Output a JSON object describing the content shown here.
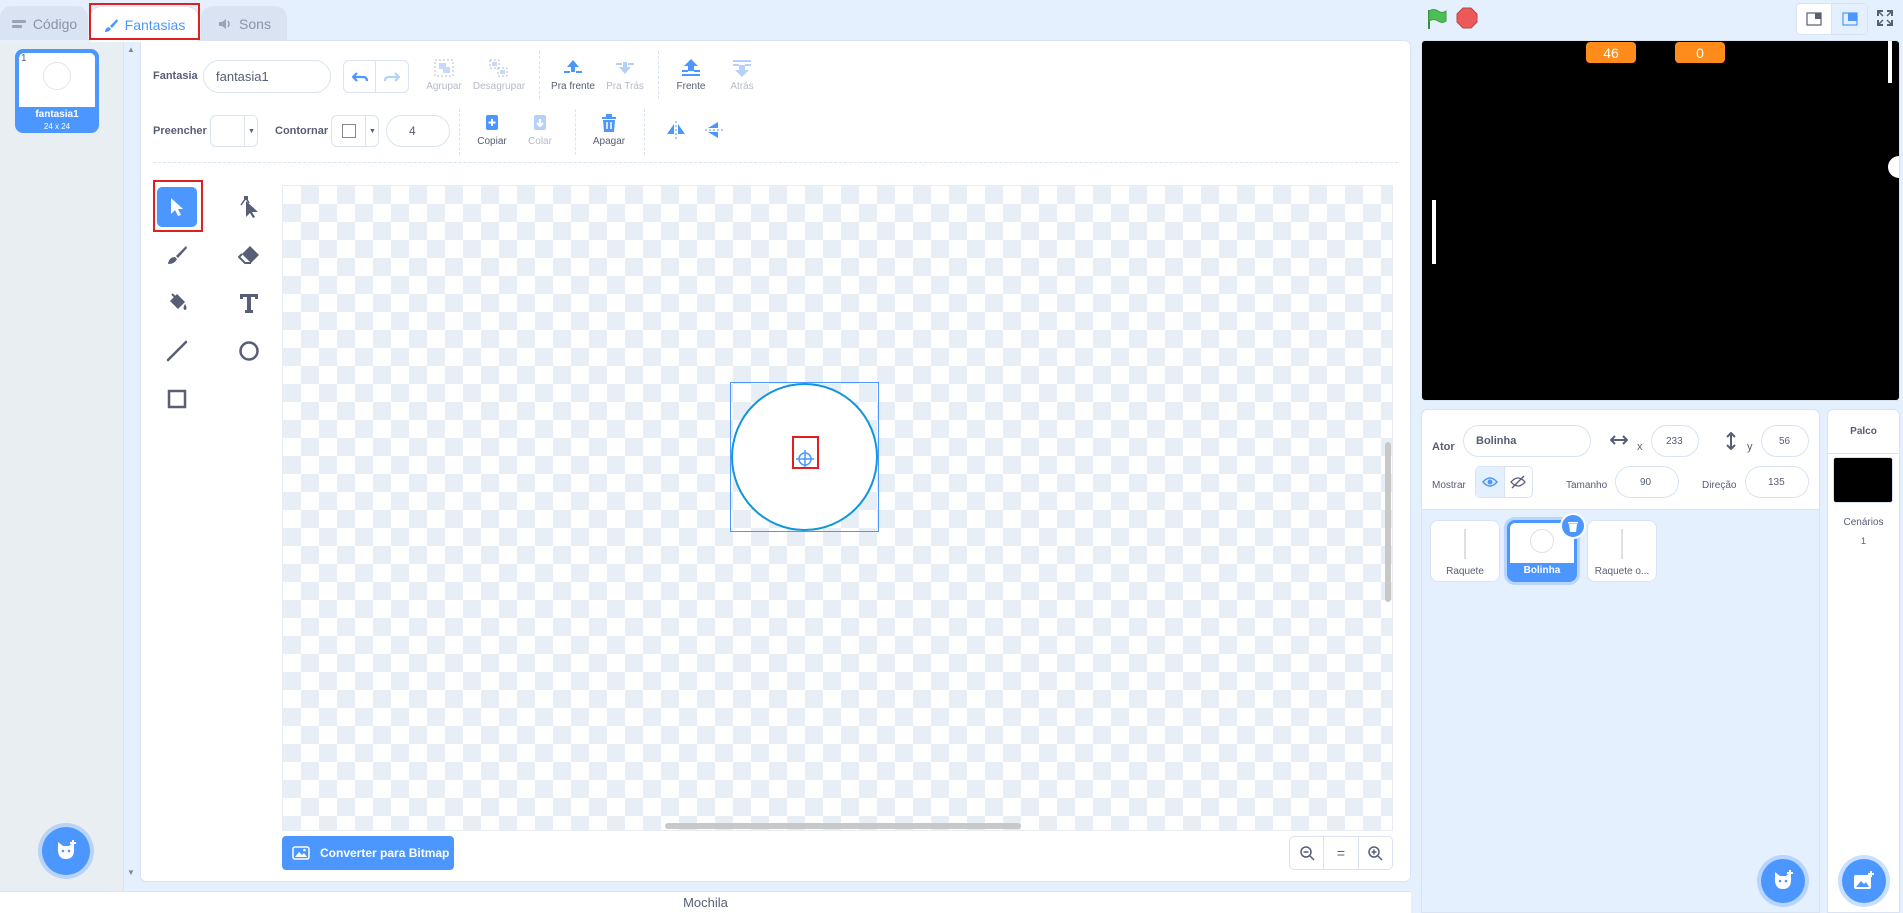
{
  "tabs": [
    {
      "label": "Código"
    },
    {
      "label": "Fantasias"
    },
    {
      "label": "Sons"
    }
  ],
  "costume_list": {
    "number": "1",
    "name": "fantasia1",
    "size": "24 x 24"
  },
  "toolbar": {
    "costume_label": "Fantasia",
    "costume_name": "fantasia1",
    "group": "Agrupar",
    "ungroup": "Desagrupar",
    "forward": "Pra frente",
    "backward": "Pra Trás",
    "front": "Frente",
    "back": "Atrás",
    "fill_label": "Preencher",
    "outline_label": "Contornar",
    "outline_width": "4",
    "copy": "Copiar",
    "paste": "Colar",
    "delete": "Apagar"
  },
  "convert_button": "Converter para Bitmap",
  "zoom": {
    "equal": "="
  },
  "backpack": "Mochila",
  "stage": {
    "monitor_left": "46",
    "monitor_right": "0"
  },
  "sprite_info": {
    "sprite_label": "Ator",
    "sprite_name": "Bolinha",
    "x_label": "x",
    "x_value": "233",
    "y_label": "y",
    "y_value": "56",
    "show_label": "Mostrar",
    "size_label": "Tamanho",
    "size_value": "90",
    "direction_label": "Direção",
    "direction_value": "135"
  },
  "sprites": [
    {
      "name": "Raquete"
    },
    {
      "name": "Bolinha"
    },
    {
      "name": "Raquete o..."
    }
  ],
  "stage_panel": {
    "title": "Palco",
    "backdrops_label": "Cenários",
    "backdrops_count": "1"
  },
  "colors": {
    "accent": "#4c97ff",
    "monitor": "#ff8c1a",
    "highlight": "#e02020"
  }
}
